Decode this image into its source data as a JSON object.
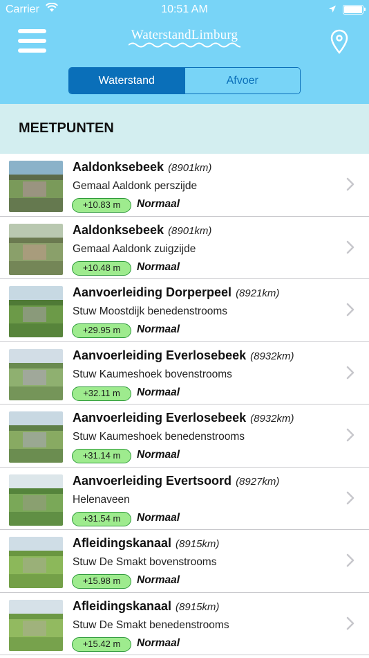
{
  "status_bar": {
    "carrier": "Carrier",
    "time": "10:51 AM"
  },
  "header": {
    "logo_text": "WaterstandLimburg",
    "menu_icon": "hamburger-menu-icon",
    "location_icon": "location-pin-icon",
    "tabs": [
      {
        "label": "Waterstand",
        "active": true
      },
      {
        "label": "Afvoer",
        "active": false
      }
    ]
  },
  "section": {
    "title": "MEETPUNTEN"
  },
  "rows": [
    {
      "name": "Aaldonksebeek",
      "km": "(8901km)",
      "location": "Gemaal Aaldonk perszijde",
      "level": "+10.83 m",
      "status": "Normaal"
    },
    {
      "name": "Aaldonksebeek",
      "km": "(8901km)",
      "location": "Gemaal Aaldonk zuigzijde",
      "level": "+10.48 m",
      "status": "Normaal"
    },
    {
      "name": "Aanvoerleiding Dorperpeel",
      "km": "(8921km)",
      "location": "Stuw Moostdijk benedenstrooms",
      "level": "+29.95 m",
      "status": "Normaal"
    },
    {
      "name": "Aanvoerleiding Everlosebeek",
      "km": "(8932km)",
      "location": "Stuw Kaumeshoek bovenstrooms",
      "level": "+32.11 m",
      "status": "Normaal"
    },
    {
      "name": "Aanvoerleiding Everlosebeek",
      "km": "(8932km)",
      "location": "Stuw Kaumeshoek benedenstrooms",
      "level": "+31.14 m",
      "status": "Normaal"
    },
    {
      "name": "Aanvoerleiding Evertsoord",
      "km": "(8927km)",
      "location": "Helenaveen",
      "level": "+31.54 m",
      "status": "Normaal"
    },
    {
      "name": "Afleidingskanaal",
      "km": "(8915km)",
      "location": "Stuw De Smakt bovenstrooms",
      "level": "+15.98 m",
      "status": "Normaal"
    },
    {
      "name": "Afleidingskanaal",
      "km": "(8915km)",
      "location": "Stuw De Smakt benedenstrooms",
      "level": "+15.42 m",
      "status": "Normaal"
    }
  ],
  "colors": {
    "header_bg": "#78d4f7",
    "accent": "#0a6fb9",
    "section_bg": "#d3eef0",
    "badge_bg": "#9eeb8e",
    "badge_border": "#2e9a3a"
  }
}
